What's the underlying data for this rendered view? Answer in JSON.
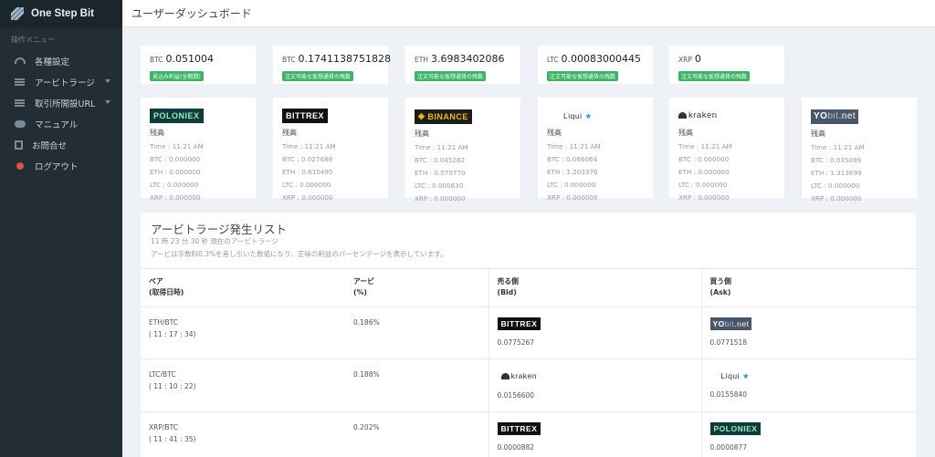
{
  "app": {
    "title": "One Step Bit"
  },
  "sidebar": {
    "heading": "操作メニュー",
    "items": [
      {
        "label": "各種設定",
        "icon": "dashboard-icon"
      },
      {
        "label": "アービトラージ",
        "icon": "bars-icon",
        "expandable": true
      },
      {
        "label": "取引所開設URL",
        "icon": "bars-icon",
        "expandable": true
      },
      {
        "label": "マニュアル",
        "icon": "chat-icon"
      },
      {
        "label": "お問合せ",
        "icon": "document-icon"
      },
      {
        "label": "ログアウト",
        "icon": "power-off-icon"
      }
    ]
  },
  "header": {
    "title": "ユーザーダッシュボード"
  },
  "balances": [
    {
      "symbol": "BTC",
      "value": "0.051004",
      "badge": "見込み利益(全期間)"
    },
    {
      "symbol": "BTC",
      "value": "0.1741138751828",
      "badge": "注文可能な仮想通貨の残数"
    },
    {
      "symbol": "ETH",
      "value": "3.6983402086",
      "badge": "注文可能な仮想通貨の残数"
    },
    {
      "symbol": "LTC",
      "value": "0.00083000445",
      "badge": "注文可能な仮想通貨の残数"
    },
    {
      "symbol": "XRP",
      "value": "0",
      "badge": "注文可能な仮想通貨の残数"
    }
  ],
  "exchanges": [
    {
      "name": "POLONIEX",
      "label": "残高",
      "time": "Time : 11:21 AM",
      "btc": "BTC : 0.000000",
      "eth": "ETH : 0.000000",
      "ltc": "LTC : 0.000000",
      "xrp": "XRP : 0.000000"
    },
    {
      "name": "BITTREX",
      "label": "残高",
      "time": "Time : 11:21 AM",
      "btc": "BTC : 0.027688",
      "eth": "ETH : 0.610495",
      "ltc": "LTC : 0.000000",
      "xrp": "XRP : 0.000000"
    },
    {
      "name": "BINANCE",
      "label": "残高",
      "time": "Time : 11:21 AM",
      "btc": "BTC : 0.045262",
      "eth": "ETH : 0.570770",
      "ltc": "LTC : 0.000830",
      "xrp": "XRP : 0.000000"
    },
    {
      "name": "Liqui",
      "label": "残高",
      "time": "Time : 11:21 AM",
      "btc": "BTC : 0.066064",
      "eth": "ETH : 1.203376",
      "ltc": "LTC : 0.000000",
      "xrp": "XRP : 0.000000"
    },
    {
      "name": "kraken",
      "label": "残高",
      "time": "Time : 11:21 AM",
      "btc": "BTC : 0.000000",
      "eth": "ETH : 0.000000",
      "ltc": "LTC : 0.000000",
      "xrp": "XRP : 0.000000"
    },
    {
      "name": "YObit.net",
      "name_parts": [
        "YO",
        "bit",
        ".net"
      ],
      "label": "残高",
      "time": "Time : 11:21 AM",
      "btc": "BTC : 0.035099",
      "eth": "ETH : 1.313699",
      "ltc": "LTC : 0.000000",
      "xrp": "XRP : 0.000000"
    }
  ],
  "arbitrage": {
    "title": "アービトラージ発生リスト",
    "subtitle": "11 時 23 分 30 秒 現在のアービトラージ",
    "note": "アービは手数料0.3%を差し引いた数値になり、正味の利益のパーセンテージを表示しています。",
    "headers": {
      "pair": [
        "ペア",
        "(取得日時)"
      ],
      "arb": [
        "アービ",
        "(%)"
      ],
      "bid": [
        "売る側",
        "(Bid)"
      ],
      "ask": [
        "買う側",
        "(Ask)"
      ]
    },
    "rows": [
      {
        "pair": "ETH/BTC",
        "time": "( 11 : 17 : 34)",
        "arb": "0.186%",
        "bid_exchange": "BITTREX",
        "bid_price": "0.0775267",
        "ask_exchange": "YObit.net",
        "ask_price": "0.0771518"
      },
      {
        "pair": "LTC/BTC",
        "time": "( 11 : 10 : 22)",
        "arb": "0.188%",
        "bid_exchange": "kraken",
        "bid_price": "0.0156600",
        "ask_exchange": "Liqui",
        "ask_price": "0.0155840"
      },
      {
        "pair": "XRP/BTC",
        "time": "( 11 : 41 : 35)",
        "arb": "0.202%",
        "bid_exchange": "BITTREX",
        "bid_price": "0.0000882",
        "ask_exchange": "POLONIEX",
        "ask_price": "0.0000877"
      }
    ]
  }
}
